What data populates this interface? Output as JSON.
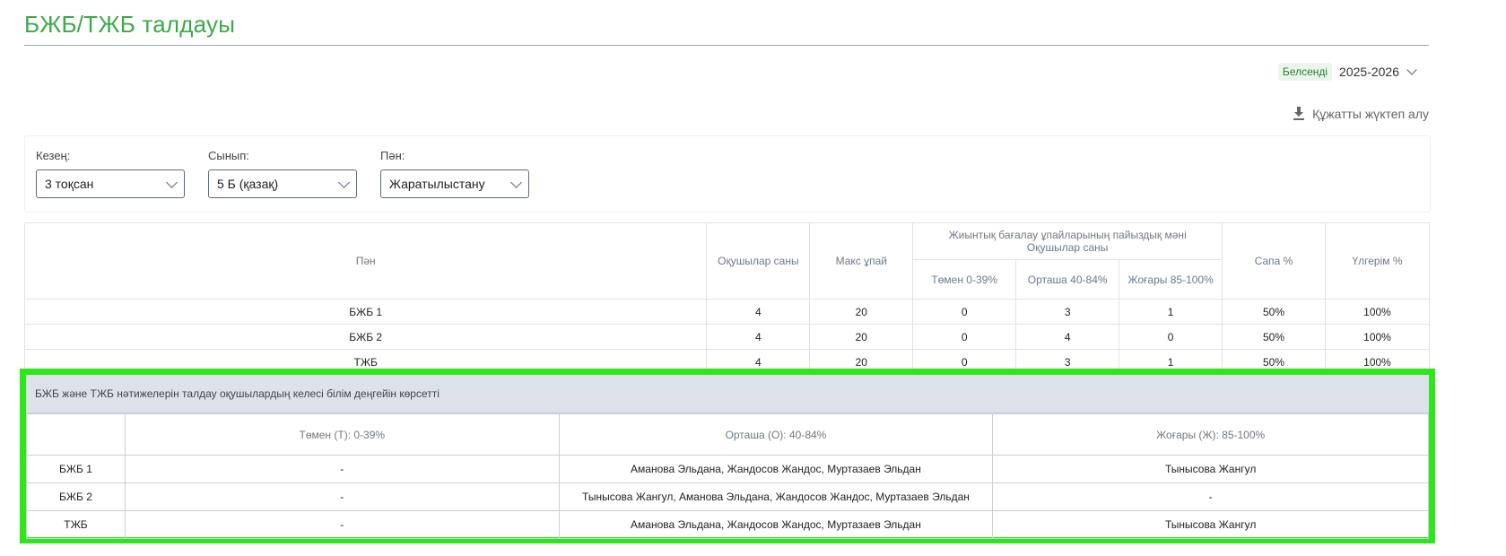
{
  "page": {
    "title": "БЖБ/ТЖБ талдауы"
  },
  "year": {
    "badge": "Белсенді",
    "value": "2025-2026"
  },
  "download": {
    "label": "Құжатты жүктеп алу"
  },
  "filters": [
    {
      "label": "Кезең:",
      "value": "3 тоқсан"
    },
    {
      "label": "Сынып:",
      "value": "5 Б (қазақ)"
    },
    {
      "label": "Пән:",
      "value": "Жаратылыстану"
    }
  ],
  "summary": {
    "headers": {
      "subject": "Пән",
      "students": "Оқушылар саны",
      "max": "Макс ұпай",
      "group_line1": "Жиынтық бағалау ұпайларының пайыздық мәні",
      "group_line2": "Оқушылар саны",
      "low": "Төмен 0-39%",
      "mid": "Орташа 40-84%",
      "high": "Жоғары 85-100%",
      "quality": "Сапа %",
      "progress": "Үлгерім %"
    },
    "rows": [
      {
        "name": "БЖБ 1",
        "students": "4",
        "max": "20",
        "low": "0",
        "mid": "3",
        "high": "1",
        "quality": "50%",
        "progress": "100%"
      },
      {
        "name": "БЖБ 2",
        "students": "4",
        "max": "20",
        "low": "0",
        "mid": "4",
        "high": "0",
        "quality": "50%",
        "progress": "100%"
      },
      {
        "name": "ТЖБ",
        "students": "4",
        "max": "20",
        "low": "0",
        "mid": "3",
        "high": "1",
        "quality": "50%",
        "progress": "100%"
      }
    ]
  },
  "analysis": {
    "heading": "БЖБ және ТЖБ нәтижелерін талдау оқушылардың келесі білім деңгейін көрсетті",
    "headers": {
      "low": "Төмен (Т): 0-39%",
      "mid": "Орташа (О): 40-84%",
      "high": "Жоғары (Ж): 85-100%"
    },
    "rows": [
      {
        "name": "БЖБ 1",
        "low": "-",
        "mid": "Аманова Эльдана, Жандосов Жандос, Муртазаев Эльдан",
        "high": "Тынысова Жангул"
      },
      {
        "name": "БЖБ 2",
        "low": "-",
        "mid": "Тынысова Жангул, Аманова Эльдана, Жандосов Жандос, Муртазаев Эльдан",
        "high": "-"
      },
      {
        "name": "ТЖБ",
        "low": "-",
        "mid": "Аманова Эльдана, Жандосов Жандос, Муртазаев Эльдан",
        "high": "Тынысова Жангул"
      }
    ]
  },
  "colors": {
    "accent": "#3ea94b",
    "highlight": "#2ee61b"
  }
}
